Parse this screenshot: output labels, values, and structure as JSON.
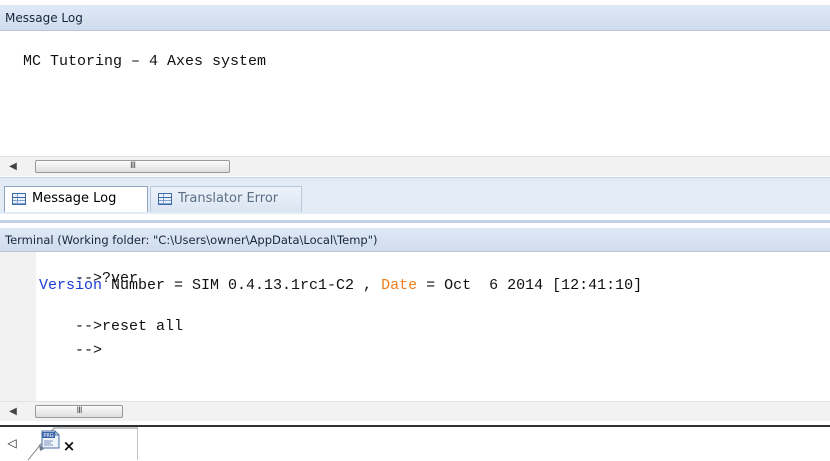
{
  "message_log": {
    "title": "Message Log",
    "text": "MC Tutoring – 4 Axes system",
    "scroll_thumb_glyph": "III"
  },
  "tabs": [
    {
      "label": "Message Log",
      "active": true
    },
    {
      "label": "Translator Error",
      "active": false
    }
  ],
  "terminal": {
    "title": "Terminal (Working folder: \"C:\\Users\\owner\\AppData\\Local\\Temp\")",
    "lines": {
      "line1": "-->?ver",
      "line2": {
        "kw1": "Version",
        "part1": " Number = SIM 0.4.13.1rc1-C2 , ",
        "kw2": "Date",
        "part2": " = Oct  6 2014 [12:41:10]"
      },
      "line3": "-->reset all",
      "line4": "-->"
    },
    "scroll_thumb_glyph": "III"
  },
  "document_tabs": {
    "icon_label": "PRG",
    "close_glyph": "×",
    "left_arrow_glyph": "◁"
  },
  "colors": {
    "keyword_blue": "#1a3dd6",
    "keyword_orange": "#ef7d1a",
    "panel_header_bg": "#d6e2f1"
  }
}
